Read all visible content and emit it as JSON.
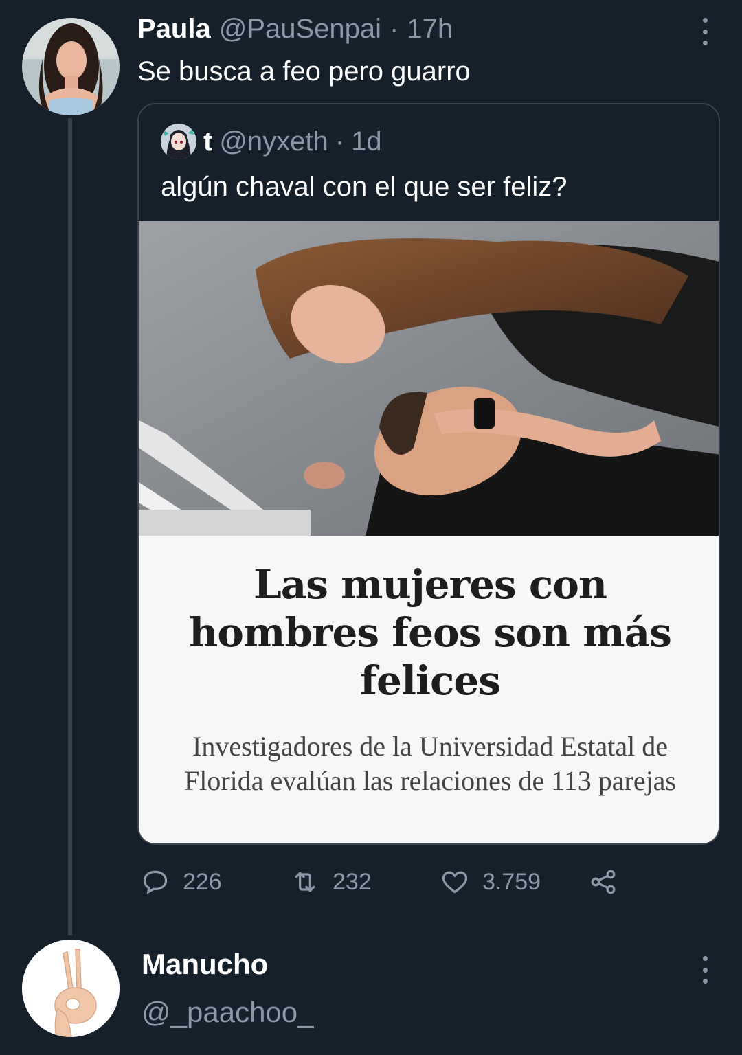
{
  "tweet": {
    "author_name": "Paula",
    "author_handle": "@PauSenpai",
    "separator": "·",
    "time": "17h",
    "text": "Se busca a feo pero guarro",
    "avatar_icon": "profile-photo-woman"
  },
  "quoted_tweet": {
    "author_name": "t",
    "author_handle": "@nyxeth",
    "separator": "·",
    "time": "1d",
    "text": "algún chaval con el que ser feliz?",
    "avatar_icon": "anime-avatar",
    "media": {
      "photo_description_icon": "couple-photo",
      "headline": "Las mujeres con hombres feos son más felices",
      "subheadline": "Investigadores de la Universidad Estatal de Florida evalúan las relaciones de 113 parejas"
    }
  },
  "actions": {
    "reply_count": "226",
    "retweet_count": "232",
    "like_count": "3.759",
    "reply_icon": "reply-icon",
    "retweet_icon": "retweet-icon",
    "like_icon": "heart-icon",
    "share_icon": "share-icon"
  },
  "reply_user": {
    "name": "Manucho",
    "handle": "@_paachoo_",
    "avatar_icon": "ok-hand-gesture"
  },
  "colors": {
    "background": "#15202b",
    "border": "#38444d",
    "secondary_text": "#8b98a5",
    "primary_text": "#ffffff"
  }
}
